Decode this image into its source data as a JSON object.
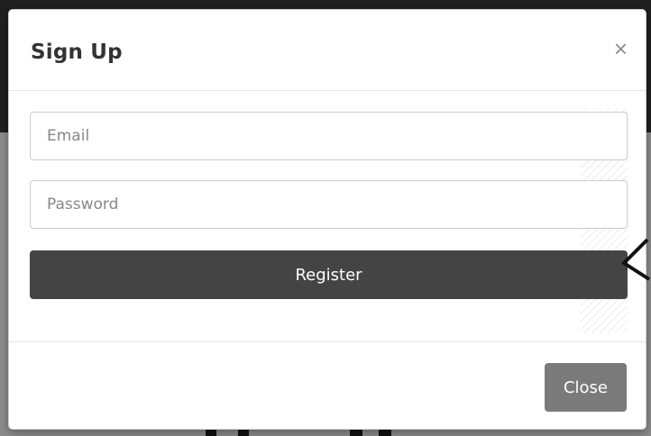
{
  "modal": {
    "title": "Sign Up",
    "close_icon_glyph": "×",
    "email": {
      "placeholder": "Email",
      "value": ""
    },
    "password": {
      "placeholder": "Password",
      "value": ""
    },
    "register_label": "Register",
    "close_label": "Close"
  },
  "colors": {
    "primary_button": "#444444",
    "secondary_button": "#7a7a7a",
    "overlay_dark": "#1f1f1f",
    "overlay_light": "#8c8c8c"
  },
  "icons": {
    "close": "close-icon",
    "annotation_arrow": "arrow-icon"
  }
}
